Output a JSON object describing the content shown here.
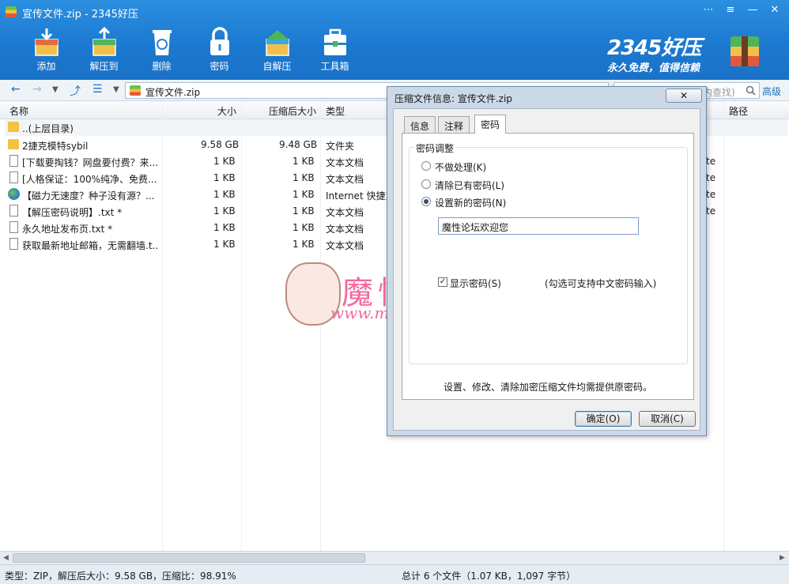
{
  "window": {
    "title": "宣传文件.zip - 2345好压",
    "controls": [
      "⋯",
      "≡",
      "—",
      "✕"
    ]
  },
  "toolbar": {
    "items": [
      {
        "label": "添加",
        "icon": "add-box-icon"
      },
      {
        "label": "解压到",
        "icon": "extract-box-icon"
      },
      {
        "label": "删除",
        "icon": "recycle-bin-icon"
      },
      {
        "label": "密码",
        "icon": "lock-icon"
      },
      {
        "label": "自解压",
        "icon": "self-extract-icon"
      },
      {
        "label": "工具箱",
        "icon": "toolbox-icon"
      }
    ]
  },
  "brand": {
    "name": "2345好压",
    "slogan": "永久免费，值得信赖"
  },
  "address": {
    "path": "宣传文件.zip",
    "search_placeholder": "内查找)",
    "advanced": "高级"
  },
  "columns": [
    "名称",
    "大小",
    "压缩后大小",
    "类型",
    "路径"
  ],
  "files": [
    {
      "name": "..(上层目录)",
      "size": "",
      "packed": "",
      "type": "",
      "icon": "folder-icon"
    },
    {
      "name": "2捷克模特sybil",
      "size": "9.58 GB",
      "packed": "9.48 GB",
      "type": "文件夹",
      "icon": "folder-icon"
    },
    {
      "name": "[下载要掏钱？网盘要付费？来...",
      "size": "1 KB",
      "packed": "1 KB",
      "type": "文本文档",
      "icon": "text-file-icon"
    },
    {
      "name": "[人格保证：100%纯净、免费...",
      "size": "1 KB",
      "packed": "1 KB",
      "type": "文本文档",
      "icon": "text-file-icon"
    },
    {
      "name": "【磁力无速度？种子没有源？...",
      "size": "1 KB",
      "packed": "1 KB",
      "type": "Internet 快捷方式",
      "icon": "internet-shortcut-icon"
    },
    {
      "name": "【解压密码说明】.txt *",
      "size": "1 KB",
      "packed": "1 KB",
      "type": "文本文档",
      "icon": "text-file-icon"
    },
    {
      "name": "永久地址发布页.txt *",
      "size": "1 KB",
      "packed": "1 KB",
      "type": "文本文档",
      "icon": "text-file-icon"
    },
    {
      "name": "获取最新地址邮箱，无需翻墙.t...",
      "size": "1 KB",
      "packed": "1 KB",
      "type": "文本文档",
      "icon": "text-file-icon"
    }
  ],
  "path_col_peek": [
    "te",
    "te",
    "te",
    "te"
  ],
  "watermark": {
    "cn": "魔性论坛",
    "url": "www.moxing.cool"
  },
  "dialog": {
    "title": "压缩文件信息: 宣传文件.zip",
    "close_label": "✕",
    "tabs": [
      "信息",
      "注释",
      "密码"
    ],
    "active_tab": "密码",
    "group_label": "密码调整",
    "options": [
      {
        "label": "不做处理(K)",
        "checked": false
      },
      {
        "label": "清除已有密码(L)",
        "checked": false
      },
      {
        "label": "设置新的密码(N)",
        "checked": true
      }
    ],
    "password_value": "魔性论坛欢迎您",
    "show_password_label": "显示密码(S)",
    "show_password_checked": true,
    "hint": "(勾选可支持中文密码输入)",
    "note": "设置、修改、清除加密压缩文件均需提供原密码。",
    "ok": "确定(O)",
    "cancel": "取消(C)"
  },
  "status": {
    "left": "类型：ZIP，解压后大小：9.58 GB，压缩比：98.91%",
    "right": "总计 6 个文件（1.07 KB，1,097 字节）"
  }
}
